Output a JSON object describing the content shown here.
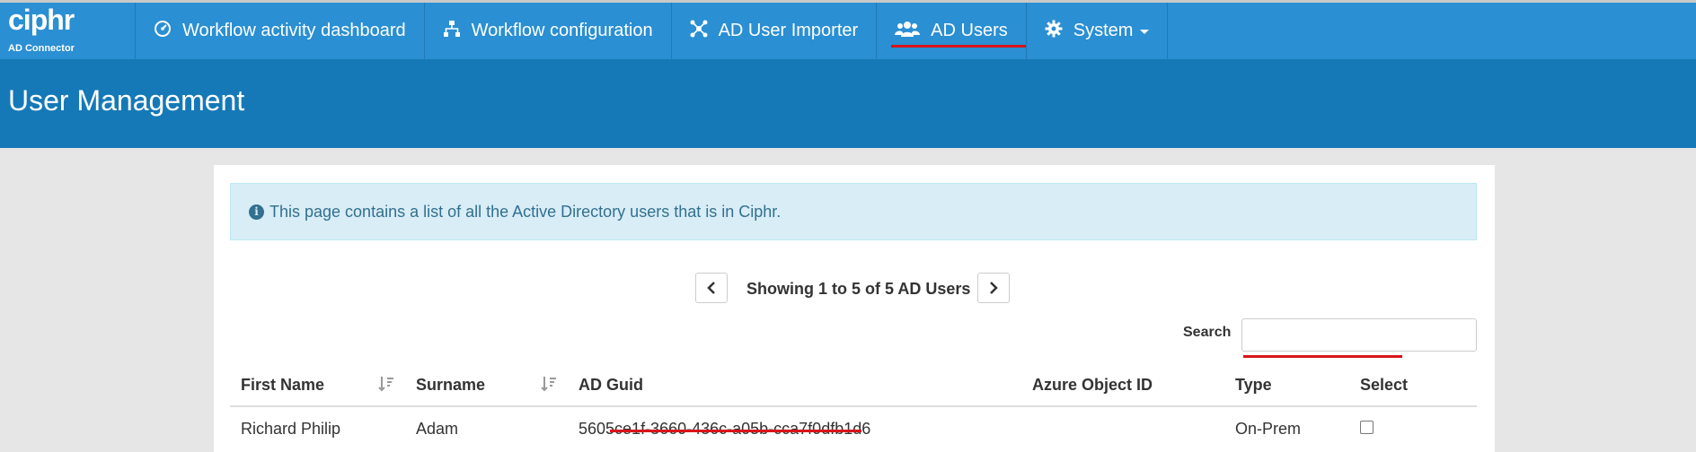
{
  "brand": {
    "logo": "ciphr",
    "subtitle": "AD Connector"
  },
  "nav": {
    "items": [
      {
        "label": "Workflow activity dashboard",
        "icon": "dashboard-icon"
      },
      {
        "label": "Workflow configuration",
        "icon": "sitemap-icon"
      },
      {
        "label": "AD User Importer",
        "icon": "network-icon"
      },
      {
        "label": "AD Users",
        "icon": "users-icon",
        "active": true
      },
      {
        "label": "System",
        "icon": "gear-icon",
        "dropdown": true
      }
    ]
  },
  "header": {
    "title": "User Management"
  },
  "info": {
    "text": "This page contains a list of all the Active Directory users that is in Ciphr."
  },
  "pager": {
    "text": "Showing 1 to 5 of 5 AD Users"
  },
  "search": {
    "label": "Search",
    "value": ""
  },
  "table": {
    "columns": [
      "First Name",
      "Surname",
      "AD Guid",
      "Azure Object ID",
      "Type",
      "Select"
    ],
    "rows": [
      {
        "first_name": "Richard Philip",
        "surname": "Adam",
        "ad_guid": "5605ce1f-3660-436c-a05b-cca7f0dfb1d6",
        "azure_object_id": "",
        "type": "On-Prem",
        "selected": false
      }
    ]
  },
  "colors": {
    "navbar": "#2a8fd3",
    "header": "#1679b7",
    "accent_red": "#d7141a",
    "info_bg": "#d9edf7"
  }
}
